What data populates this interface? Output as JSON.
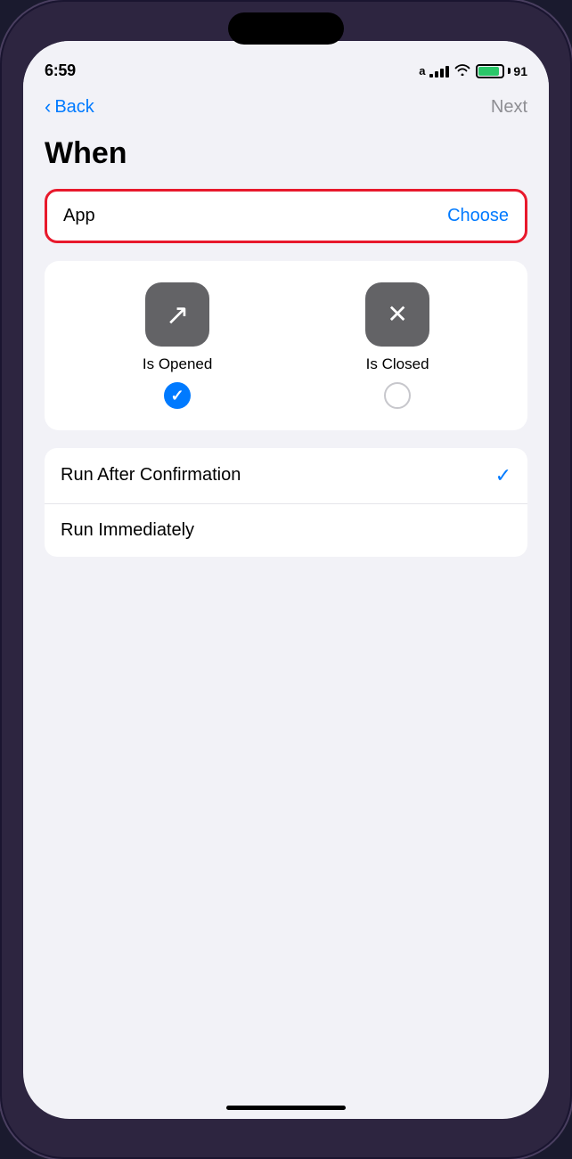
{
  "statusBar": {
    "time": "6:59",
    "batteryPercent": "91",
    "dataIcon": "a-icon"
  },
  "nav": {
    "backLabel": "Back",
    "nextLabel": "Next"
  },
  "page": {
    "title": "When"
  },
  "appRow": {
    "label": "App",
    "chooseLabel": "Choose"
  },
  "options": {
    "isOpened": {
      "label": "Is Opened",
      "checked": true
    },
    "isClosed": {
      "label": "Is Closed",
      "checked": false
    }
  },
  "runOptions": {
    "items": [
      {
        "label": "Run After Confirmation",
        "checked": true
      },
      {
        "label": "Run Immediately",
        "checked": false
      }
    ]
  }
}
